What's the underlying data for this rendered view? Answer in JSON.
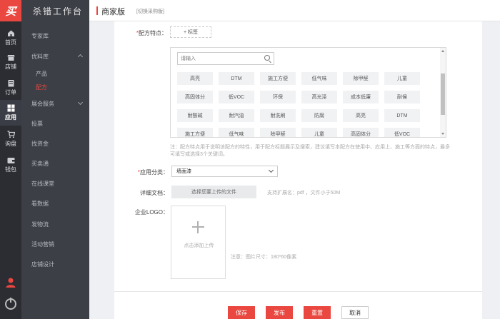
{
  "app": {
    "logo_text": "买",
    "brand": "杀错工作台",
    "page_title": "商家版",
    "switch_link": "[切换采购版]"
  },
  "rail": {
    "items": [
      {
        "label": "首页",
        "icon": "home-icon"
      },
      {
        "label": "店铺",
        "icon": "store-icon"
      },
      {
        "label": "订单",
        "icon": "order-icon"
      },
      {
        "label": "应用",
        "icon": "apps-icon"
      },
      {
        "label": "询盘",
        "icon": "cart-icon"
      },
      {
        "label": "钱包",
        "icon": "wallet-icon"
      }
    ]
  },
  "sidebar": {
    "items": [
      "专家库",
      "优料库",
      "产品",
      "配方",
      "展会服务",
      "投票",
      "找资金",
      "买卖通",
      "在线课堂",
      "看数据",
      "发物流",
      "活动营销",
      "店铺设计"
    ]
  },
  "form": {
    "feature_label": "配方特点：",
    "add_tag_label": "+ 标签",
    "search_placeholder": "请输入",
    "tags": [
      "高亮",
      "DTM",
      "施工方便",
      "低气味",
      "除甲醛",
      "儿童",
      "高固体分",
      "低VOC",
      "环保",
      "高光泽",
      "成本低廉",
      "耐候",
      "耐酸碱",
      "耐汽油",
      "耐洗刷",
      "防腐",
      "高亮",
      "DTM",
      "施工方便",
      "低气味",
      "除甲醛",
      "儿童",
      "高固体分",
      "低VOC"
    ],
    "feature_note": "注：配方特点用于说明该配方的特性，用于配方标题展示及搜索，建议填写本配方在使用中、应用上、施工等方面的特点，最多可填写或选择3个关键词。",
    "category_label": "应用分类：",
    "category_value": "墙面漆",
    "doc_label": "详细文档：",
    "doc_button": "选择您要上传的文件",
    "doc_hint": "支持扩展名：pdf ，文件小于50M",
    "logo_label": "企业LOGO：",
    "logo_upload_label": "点击添加上传",
    "logo_note": "注意：图片尺寸：180*60像素"
  },
  "actions": {
    "save": "保存",
    "publish": "发布",
    "reset": "重置",
    "cancel": "取消"
  },
  "colors": {
    "accent": "#e9473f",
    "rail_bg": "#2b2d33",
    "sidebar_bg": "#3c3f46"
  }
}
